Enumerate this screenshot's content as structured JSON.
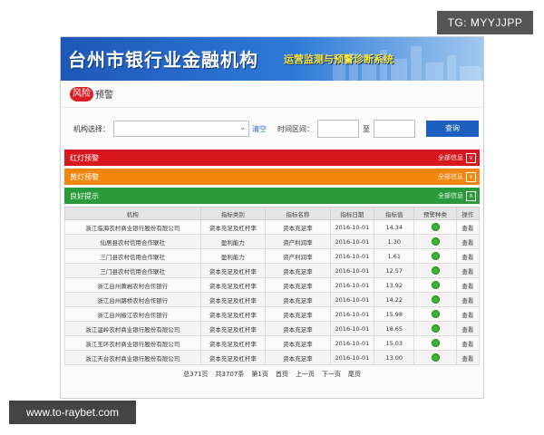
{
  "corner_tag": "TG: MYYJJPP",
  "watermark": "www.to-raybet.com",
  "banner": {
    "title": "台州市银行业金融机构",
    "subtitle": "运营监测与预警诊断系统"
  },
  "section": {
    "badge": "风险",
    "title": "预警"
  },
  "filter": {
    "org_label": "机构选择：",
    "org_value": "",
    "clear_label": "清空",
    "time_label": "时间区间：",
    "to_label": "至",
    "query_label": "查询"
  },
  "bars": {
    "red": {
      "label": "红灯预警",
      "more": "全部信息",
      "toggle": "∨"
    },
    "yellow": {
      "label": "黄灯预警",
      "more": "全部信息",
      "toggle": "∨"
    },
    "green": {
      "label": "良好提示",
      "more": "全部信息",
      "toggle": "∧"
    }
  },
  "table": {
    "headers": [
      "机构",
      "指标类别",
      "指标名称",
      "指标日期",
      "指标值",
      "预警种类",
      "操作"
    ],
    "rows": [
      [
        "浙江临海农村商业银行股份有限公司",
        "资本充足及杠杆率",
        "资本充足率",
        "2016-10-01",
        "14.34",
        "查看"
      ],
      [
        "仙居县农村信用合作联社",
        "盈利能力",
        "资产利润率",
        "2016-10-01",
        "1.30",
        "查看"
      ],
      [
        "三门县农村信用合作联社",
        "盈利能力",
        "资产利润率",
        "2016-10-01",
        "1.61",
        "查看"
      ],
      [
        "三门县农村信用合作联社",
        "资本充足及杠杆率",
        "资本充足率",
        "2016-10-01",
        "12.57",
        "查看"
      ],
      [
        "浙江台州黄岩农村合作银行",
        "资本充足及杠杆率",
        "资本充足率",
        "2016-10-01",
        "13.92",
        "查看"
      ],
      [
        "浙江台州路桥农村合作银行",
        "资本充足及杠杆率",
        "资本充足率",
        "2016-10-01",
        "14.22",
        "查看"
      ],
      [
        "浙江台州椒江农村合作银行",
        "资本充足及杠杆率",
        "资本充足率",
        "2016-10-01",
        "15.98",
        "查看"
      ],
      [
        "浙江温岭农村商业银行股份有限公司",
        "资本充足及杠杆率",
        "资本充足率",
        "2016-10-01",
        "18.65",
        "查看"
      ],
      [
        "浙江玉环农村商业银行股份有限公司",
        "资本充足及杠杆率",
        "资本充足率",
        "2016-10-01",
        "15.03",
        "查看"
      ],
      [
        "浙江天台农村商业银行股份有限公司",
        "资本充足及杠杆率",
        "资本充足率",
        "2016-10-01",
        "13.00",
        "查看"
      ]
    ],
    "indicator_color": "#3fae3a"
  },
  "pager": {
    "total_pages": "总371页",
    "total_records": "共3707条",
    "current": "第1页",
    "first": "首页",
    "prev": "上一页",
    "next": "下一页",
    "last": "尾页"
  }
}
